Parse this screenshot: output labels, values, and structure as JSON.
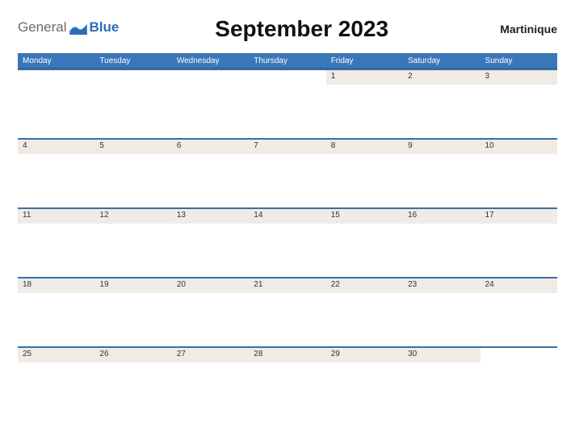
{
  "brand": {
    "part1": "General",
    "part2": "Blue"
  },
  "title": "September 2023",
  "region": "Martinique",
  "dayHeaders": [
    "Monday",
    "Tuesday",
    "Wednesday",
    "Thursday",
    "Friday",
    "Saturday",
    "Sunday"
  ],
  "weeks": [
    [
      "",
      "",
      "",
      "",
      "1",
      "2",
      "3"
    ],
    [
      "4",
      "5",
      "6",
      "7",
      "8",
      "9",
      "10"
    ],
    [
      "11",
      "12",
      "13",
      "14",
      "15",
      "16",
      "17"
    ],
    [
      "18",
      "19",
      "20",
      "21",
      "22",
      "23",
      "24"
    ],
    [
      "25",
      "26",
      "27",
      "28",
      "29",
      "30",
      ""
    ]
  ]
}
